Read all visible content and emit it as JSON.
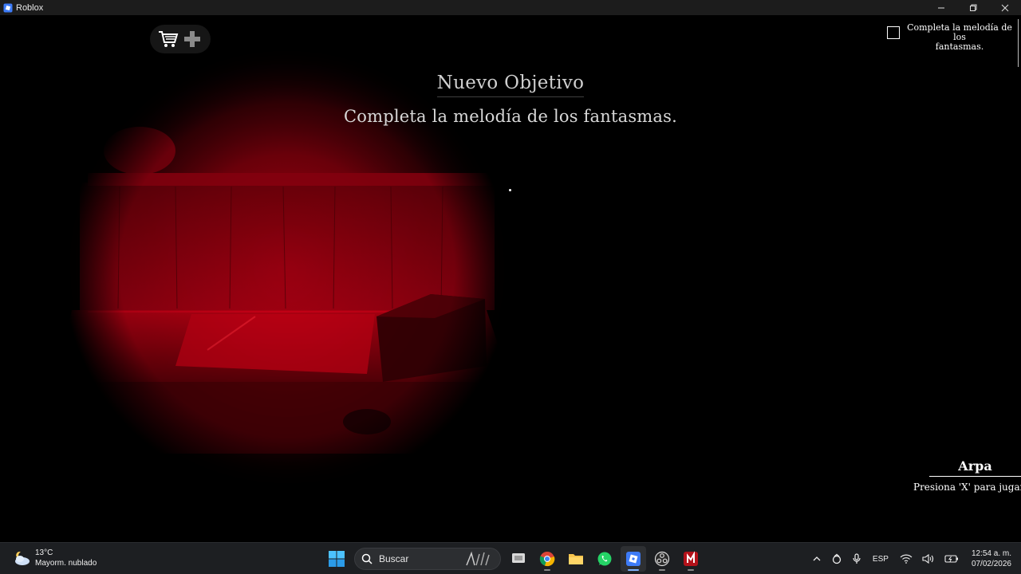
{
  "window": {
    "title": "Roblox",
    "minimize_icon": "minimize-icon",
    "restore_icon": "restore-icon",
    "close_icon": "close-icon"
  },
  "game": {
    "objective_title": "Nuevo Objetivo",
    "objective_description": "Completa la melodía de los fantasmas.",
    "quest_tracker": {
      "text_line1": "Completa la melodía de los",
      "text_line2": "fantasmas.",
      "completed": false
    },
    "interaction_prompt": {
      "name": "Arpa",
      "hint": "Presiona 'X' para jugar"
    },
    "top_buttons": [
      "shop-cart-icon",
      "dpad-icon"
    ],
    "colors": {
      "scene_red": "#b00010",
      "text_gray": "#cfcfcf"
    }
  },
  "taskbar": {
    "weather": {
      "temperature": "13°C",
      "condition": "Mayorm. nublado",
      "icon": "partly-cloudy-icon"
    },
    "search_placeholder": "Buscar",
    "apps": [
      "windows-start-icon",
      "search-icon",
      "task-view-icon",
      "chrome-icon",
      "file-explorer-icon",
      "whatsapp-icon",
      "roblox-icon",
      "obs-icon",
      "app-red-icon"
    ],
    "tray": {
      "language": "ESP",
      "time": "12:54 a. m.",
      "date": "07/02/2026"
    }
  }
}
